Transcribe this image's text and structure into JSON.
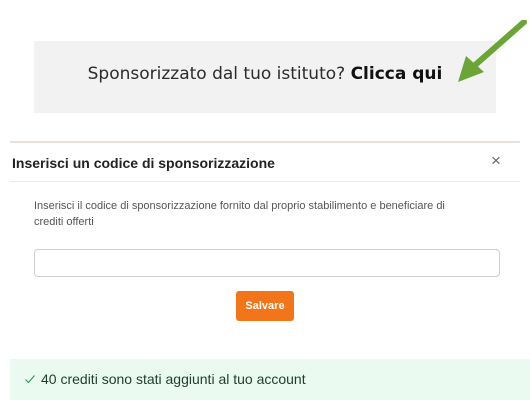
{
  "top_text": {
    "prefix": "",
    "bold": "",
    "suffix": ""
  },
  "sponsor": {
    "question": "Sponsorizzato dal tuo istituto?",
    "link": "Clicca qui"
  },
  "arrow_color": "#6aa535",
  "modal": {
    "title": "Inserisci un codice di sponsorizzazione",
    "close": "×",
    "description": "Inserisci il codice di sponsorizzazione fornito dal proprio stabilimento e beneficiare di crediti offerti",
    "input_value": "",
    "input_placeholder": "",
    "save_label": "Salvare",
    "save_color": "#f2751a"
  },
  "success": {
    "icon": "check-icon",
    "message": "40 crediti sono stati aggiunti al tuo account",
    "bg_color": "#eafaf0"
  }
}
